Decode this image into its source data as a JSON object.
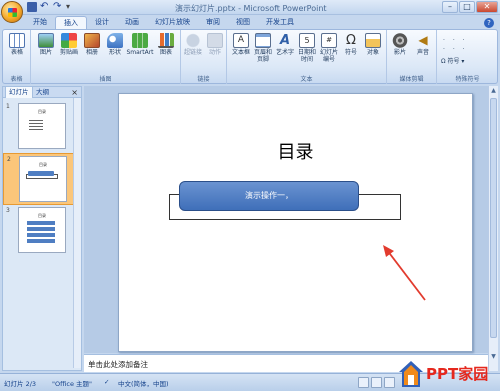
{
  "window": {
    "title": "演示幻灯片.pptx - Microsoft PowerPoint",
    "controls": [
      "–",
      "□",
      "✕"
    ]
  },
  "tabs": [
    "开始",
    "插入",
    "设计",
    "动画",
    "幻灯片放映",
    "审阅",
    "视图",
    "开发工具"
  ],
  "active_tab": "插入",
  "ribbon": {
    "groups": [
      {
        "label": "表格",
        "buttons": [
          "表格"
        ]
      },
      {
        "label": "插图",
        "buttons": [
          "图片",
          "剪贴画",
          "相册",
          "形状",
          "SmartArt",
          "图表"
        ]
      },
      {
        "label": "链接",
        "buttons": [
          "超链接",
          "动作"
        ]
      },
      {
        "label": "文本",
        "buttons": [
          "文本框",
          "页眉和页脚",
          "艺术字",
          "日期和时间",
          "幻灯片编号",
          "符号",
          "对象"
        ]
      },
      {
        "label": "媒体剪辑",
        "buttons": [
          "影片",
          "声音"
        ]
      },
      {
        "label": "特殊符号",
        "buttons": [
          "符号"
        ]
      }
    ]
  },
  "left_panel": {
    "tabs": [
      "幻灯片",
      "大纲"
    ],
    "close": "×",
    "thumbnails": [
      {
        "number": "1",
        "title": "目录"
      },
      {
        "number": "2",
        "title": "目录"
      },
      {
        "number": "3",
        "title": "目录"
      }
    ],
    "selected": 2
  },
  "slide": {
    "title": "目录",
    "shape_text": "演示操作一，"
  },
  "notes": {
    "placeholder": "单击此处添加备注"
  },
  "status": {
    "slide_indicator": "幻灯片 2/3",
    "theme": "\"Office 主题\"",
    "language": "中文(简体，中国)"
  },
  "watermark": {
    "text": "PPT家园"
  },
  "colors": {
    "accent_blue": "#4f7ec2",
    "selection_orange": "#fbc67a",
    "arrow_red": "#e23b2e"
  }
}
